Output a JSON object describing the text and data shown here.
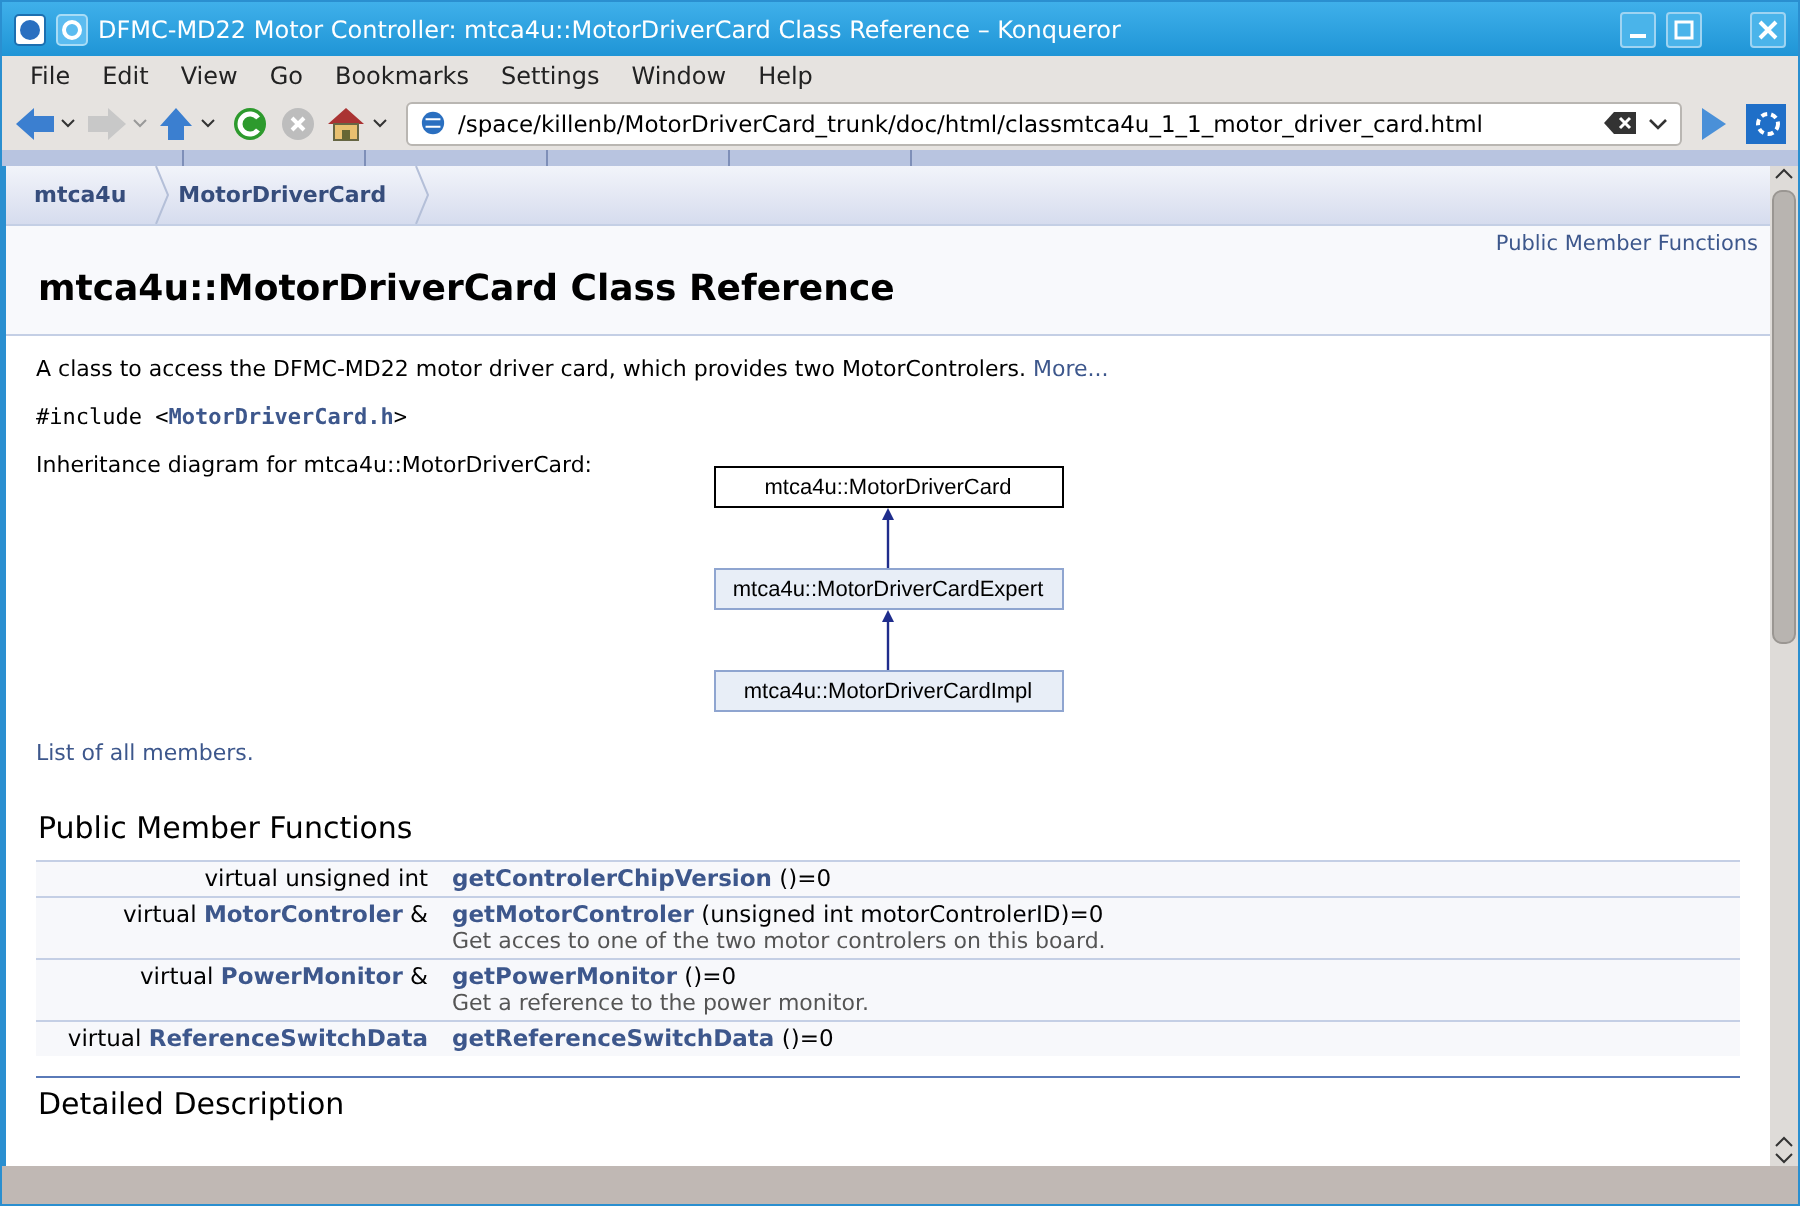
{
  "window": {
    "title": "DFMC-MD22 Motor Controller: mtca4u::MotorDriverCard Class Reference – Konqueror"
  },
  "menu": [
    "File",
    "Edit",
    "View",
    "Go",
    "Bookmarks",
    "Settings",
    "Window",
    "Help"
  ],
  "location": {
    "value": "/space/killenb/MotorDriverCard_trunk/doc/html/classmtca4u_1_1_motor_driver_card.html"
  },
  "breadcrumbs": [
    "mtca4u",
    "MotorDriverCard"
  ],
  "summary_links": [
    "Public Member Functions"
  ],
  "title": "mtca4u::MotorDriverCard Class Reference",
  "brief": {
    "text": "A class to access the DFMC-MD22 motor driver card, which provides two MotorControlers.",
    "more": "More..."
  },
  "include": {
    "prefix": "#include <",
    "file": "MotorDriverCard.h",
    "suffix": ">"
  },
  "inheritance": {
    "label": "Inheritance diagram for mtca4u::MotorDriverCard:",
    "nodes": [
      {
        "name": "mtca4u::MotorDriverCard",
        "selected": true
      },
      {
        "name": "mtca4u::MotorDriverCardExpert",
        "selected": false
      },
      {
        "name": "mtca4u::MotorDriverCardImpl",
        "selected": false
      }
    ]
  },
  "all_members_link": "List of all members.",
  "section": "Public Member Functions",
  "members": [
    {
      "type_prefix": "virtual unsigned int",
      "name": "getControlerChipVersion",
      "args": "()=0"
    },
    {
      "type_prefix": "virtual",
      "type_link": "MotorControler",
      "type_suffix": "&",
      "name": "getMotorControler",
      "args": "(unsigned int motorControlerID)=0",
      "description": "Get acces to one of the two motor controlers on this board."
    },
    {
      "type_prefix": "virtual",
      "type_link": "PowerMonitor",
      "type_suffix": "&",
      "name": "getPowerMonitor",
      "args": "()=0",
      "description": "Get a reference to the power monitor."
    },
    {
      "type_prefix": "virtual",
      "type_link": "ReferenceSwitchData",
      "name": "getReferenceSwitchData",
      "args": "()=0"
    }
  ],
  "next_section": "Detailed Description"
}
